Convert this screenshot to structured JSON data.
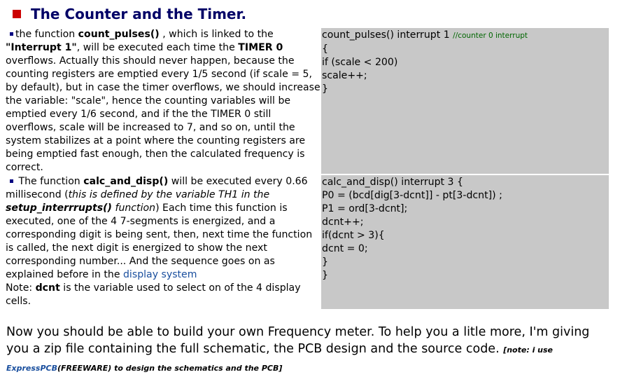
{
  "title": "The Counter and the Timer.",
  "section1": {
    "p1": "the function ",
    "fn": "count_pulses()",
    "p2": " , which is linked to the ",
    "intr": "\"Interrupt 1\"",
    "p3": ", will be executed each time the ",
    "timer": "TIMER 0",
    "p4": " overflows. Actually this should never happen, because the counting registers are emptied every 1/5 second (if scale = 5, by default), but in case the timer overflows, we should increase the variable: \"scale\", hence the counting variables will be emptied every 1/6 second, and if the the TIMER 0 still overflows, scale will be increased to 7, and so on, until the system stabilizes at a point where the counting registers are being emptied fast enough, then the calculated frequency is correct.",
    "code_head": "count_pulses() interrupt 1 ",
    "code_comment": "//counter 0 interrupt",
    "code_lines": [
      "{",
      "if (scale < 200)",
      "scale++;",
      "}"
    ]
  },
  "section2": {
    "p1": " The function ",
    "fn": "calc_and_disp()",
    "p2": " will be executed every 0.66 millisecond (",
    "italic1": "this is defined by the variable TH1 in the ",
    "bolditalic": "setup_interrrupts()",
    "italic2": " function",
    "p3": ") Each time this function is executed, one of the 4 7-segments is energized, and a corresponding digit is being sent, then, next time the function is called, the next digit is energized to show the next corresponding number... And the sequence goes on as explained before in the ",
    "link": "display system",
    "note_pre": "Note: ",
    "note_var": "dcnt",
    "note_post": " is the variable used to select on of the 4 display cells.",
    "code_lines": [
      "calc_and_disp() interrupt 3 {",
      "P0 = (bcd[dig[3-dcnt]] - pt[3-dcnt]) ;",
      "P1 = ord[3-dcnt];",
      "dcnt++;",
      "if(dcnt > 3){",
      "dcnt = 0;",
      "}",
      "}"
    ]
  },
  "footer": {
    "text": "Now you should be able to build your own Frequency meter. To help you a litle more, I'm giving you a zip file containing the full schematic, the PCB design and the source code. ",
    "note_open": "[note: i use ",
    "note_link": "ExpressPCB",
    "note_close": "(FREEWARE) to design the schematics and the PCB]"
  },
  "colors": {
    "title": "#000066",
    "title_square": "#cc0000",
    "code_bg": "#c8c8c8",
    "link": "#1a4f9e",
    "comment": "#006600"
  }
}
